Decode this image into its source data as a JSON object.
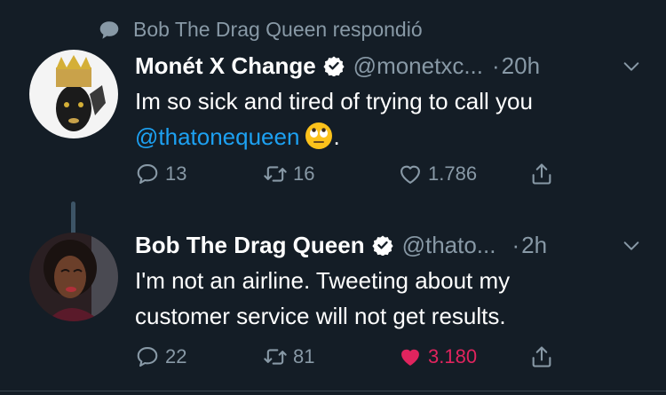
{
  "context": {
    "text": "Bob The Drag Queen respondió"
  },
  "tweets": [
    {
      "name": "Monét X Change",
      "handle": "@monetxc...",
      "dot": "·",
      "time": "20h",
      "text_before": "Im so sick and tired of trying to call you ",
      "mention": "@thatonequeen",
      "text_after": ".",
      "replies": "13",
      "retweets": "16",
      "likes": "1.786",
      "liked": false
    },
    {
      "name": "Bob The Drag Queen",
      "handle": "@thato...",
      "dot": "·",
      "time": "2h",
      "text": "I'm not an airline. Tweeting about my customer service will not get results.",
      "replies": "22",
      "retweets": "81",
      "likes": "3.180",
      "liked": true
    }
  ],
  "colors": {
    "background": "#141d26",
    "secondary_text": "#8899a6",
    "link": "#1da1f2",
    "like_active": "#e0245e",
    "verified": "#ffffff"
  }
}
